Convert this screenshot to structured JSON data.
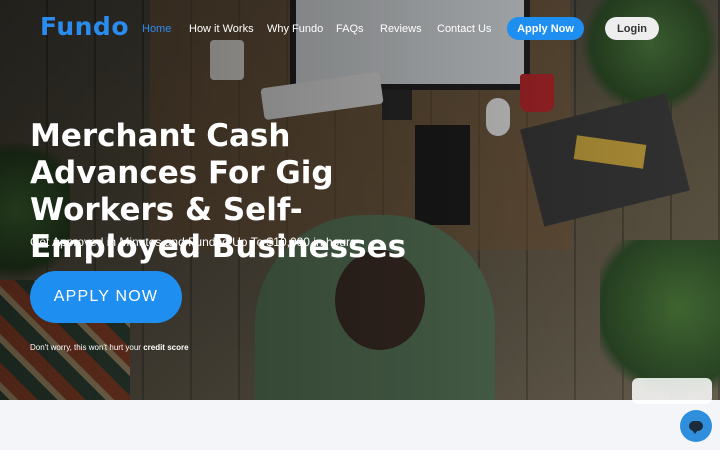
{
  "brand": {
    "logo_text": "Fundo",
    "accent_color": "#2b8cf0"
  },
  "nav": {
    "links": [
      {
        "label": "Home",
        "active": true
      },
      {
        "label": "How it Works"
      },
      {
        "label": "Why Fundo"
      },
      {
        "label": "FAQs"
      },
      {
        "label": "Reviews"
      },
      {
        "label": "Contact Us"
      }
    ],
    "apply_label": "Apply Now",
    "login_label": "Login"
  },
  "hero": {
    "headline": "Merchant Cash Advances For Gig Workers & Self-Employed Businesses",
    "subheadline": "Get Approved in Minutes and Funded Up To $10,000 in hours",
    "cta_label": "APPLY NOW",
    "disclaimer_prefix": "Don't worry, this won't hurt your",
    "disclaimer_emphasis": "credit score"
  },
  "chat": {
    "icon": "chat-icon"
  }
}
